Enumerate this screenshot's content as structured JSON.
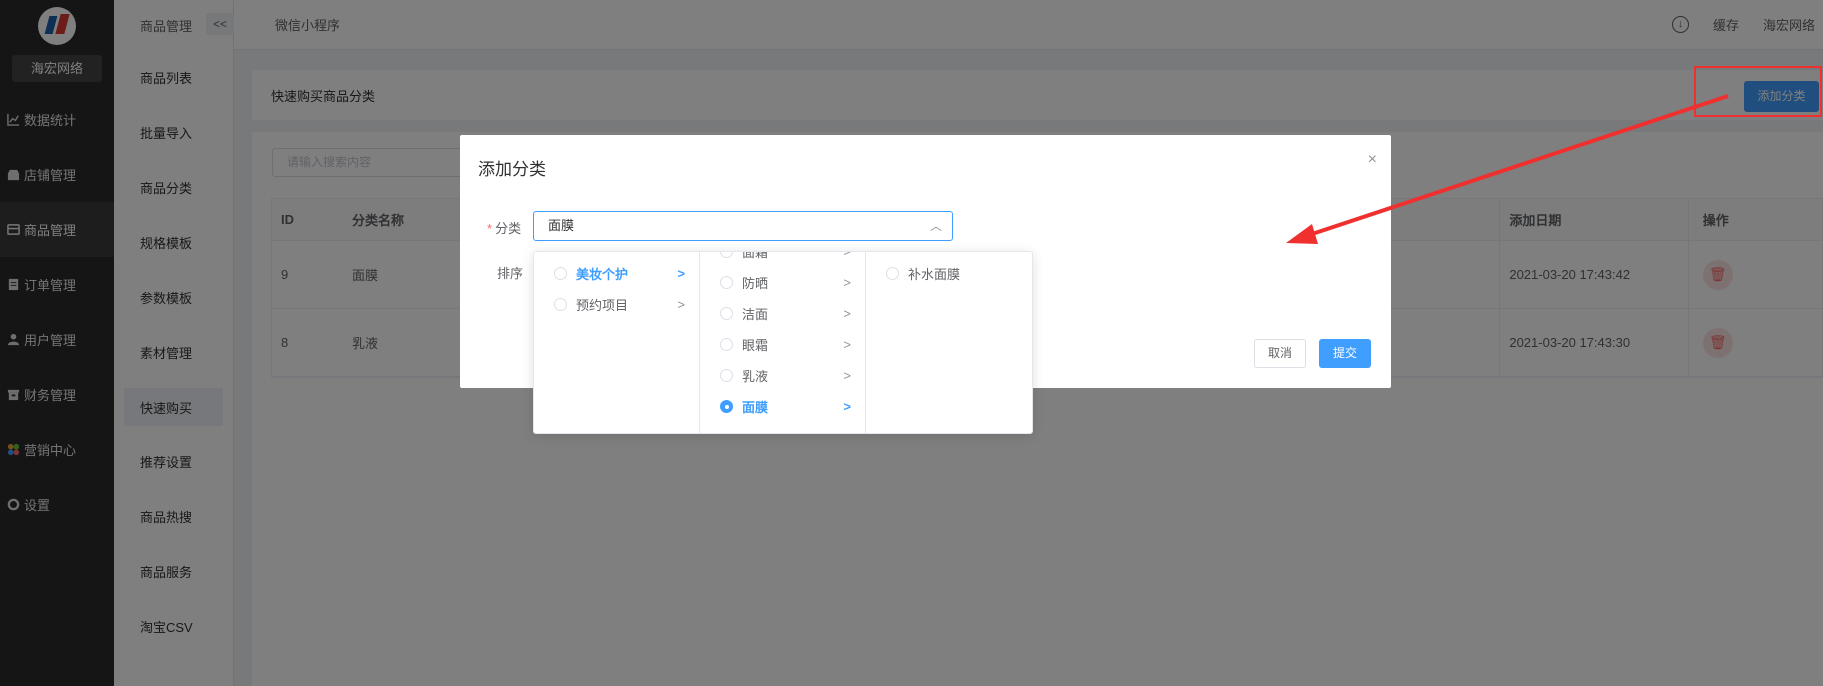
{
  "sidebar": {
    "brand": "海宏网络",
    "items": [
      {
        "label": "数据统计",
        "icon": "chart-icon"
      },
      {
        "label": "店铺管理",
        "icon": "store-icon"
      },
      {
        "label": "商品管理",
        "icon": "goods-icon"
      },
      {
        "label": "订单管理",
        "icon": "order-icon"
      },
      {
        "label": "用户管理",
        "icon": "user-icon"
      },
      {
        "label": "财务管理",
        "icon": "finance-icon"
      },
      {
        "label": "营销中心",
        "icon": "marketing-icon"
      },
      {
        "label": "设置",
        "icon": "gear-icon"
      }
    ]
  },
  "subnav": {
    "title": "商品管理",
    "collapse": "<<",
    "items": [
      "商品列表",
      "批量导入",
      "商品分类",
      "规格模板",
      "参数模板",
      "素材管理",
      "快速购买",
      "推荐设置",
      "商品热搜",
      "商品服务",
      "淘宝CSV"
    ]
  },
  "topbar": {
    "mini_program": "微信小程序",
    "cache": "缓存",
    "user": "海宏网络"
  },
  "page": {
    "title": "快速购买商品分类",
    "add_button": "添加分类",
    "search_placeholder": "请输入搜索内容"
  },
  "table": {
    "headers": {
      "id": "ID",
      "name": "分类名称",
      "date": "添加日期",
      "op": "操作"
    },
    "rows": [
      {
        "id": "9",
        "name": "面膜",
        "date": "2021-03-20 17:43:42"
      },
      {
        "id": "8",
        "name": "乳液",
        "date": "2021-03-20 17:43:30"
      }
    ]
  },
  "dialog": {
    "title": "添加分类",
    "close": "×",
    "category_label": "分类",
    "category_value": "面膜",
    "sort_label": "排序",
    "cancel": "取消",
    "submit": "提交"
  },
  "cascader": {
    "level1": [
      {
        "label": "美妆个护",
        "selected": true
      },
      {
        "label": "预约项目",
        "selected": false
      }
    ],
    "level2": [
      {
        "label": "面霜",
        "selected": false
      },
      {
        "label": "防晒",
        "selected": false
      },
      {
        "label": "洁面",
        "selected": false
      },
      {
        "label": "眼霜",
        "selected": false
      },
      {
        "label": "乳液",
        "selected": false
      },
      {
        "label": "面膜",
        "selected": true
      }
    ],
    "level3": [
      {
        "label": "补水面膜",
        "selected": false
      }
    ]
  },
  "colors": {
    "primary": "#409eff",
    "annotation_red": "#f02f2f",
    "nav_bg": "#2b2b2b"
  }
}
